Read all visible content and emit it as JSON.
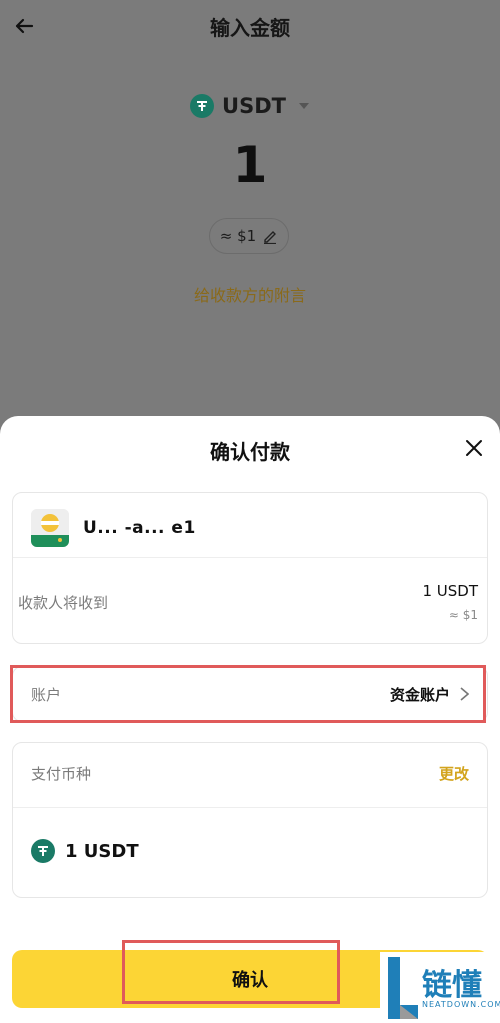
{
  "header": {
    "title": "输入金额"
  },
  "amount_screen": {
    "currency": "USDT",
    "amount": "1",
    "usd_estimate": "≈ $1",
    "memo_link": "给收款方的附言"
  },
  "sheet": {
    "title": "确认付款",
    "recipient": {
      "name": "U... -a... e1",
      "receive_label": "收款人将收到",
      "receive_amount": "1 USDT",
      "receive_usd": "≈ $1"
    },
    "account": {
      "label": "账户",
      "value": "资金账户"
    },
    "payment": {
      "label": "支付币种",
      "change": "更改",
      "amount": "1 USDT"
    },
    "confirm_label": "确认"
  },
  "watermark": {
    "text": "链懂",
    "sub": "NEATDOWN.COM"
  },
  "colors": {
    "accent": "#fcd535",
    "link": "#d3a41d",
    "usdt": "#1a7a66",
    "highlight": "#e05a5a"
  }
}
